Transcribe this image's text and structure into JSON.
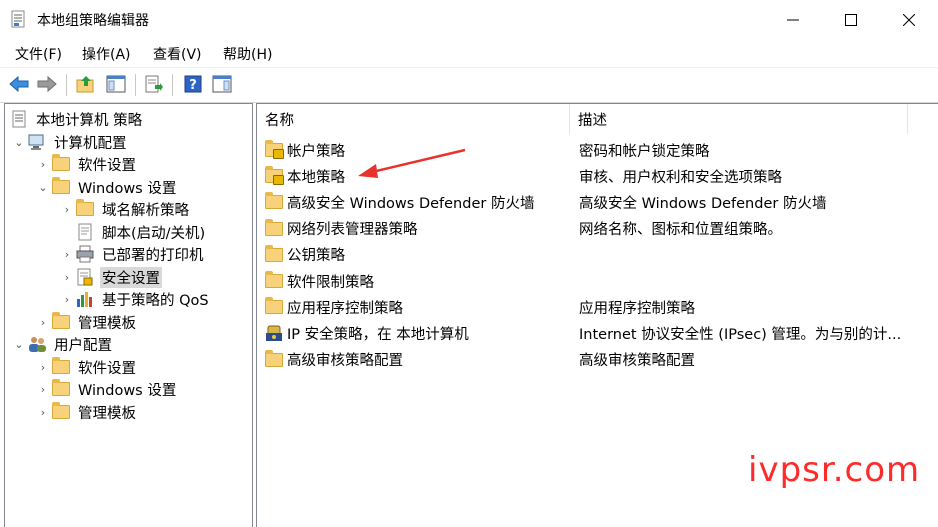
{
  "window": {
    "title": "本地组策略编辑器",
    "icon": "policy-editor-icon",
    "controls": [
      "minimize-icon",
      "maximize-icon",
      "close-icon"
    ]
  },
  "menu": {
    "file": "文件(F)",
    "action": "操作(A)",
    "view": "查看(V)",
    "help": "帮助(H)"
  },
  "toolbar": [
    "back-arrow-icon",
    "forward-arrow-icon",
    "up-folder-icon",
    "show-hide-tree-icon",
    "export-list-icon",
    "help-icon",
    "properties-icon"
  ],
  "tree": {
    "root": "本地计算机 策略",
    "computer_config": "计算机配置",
    "software_settings": "软件设置",
    "windows_settings": "Windows 设置",
    "dns_policy": "域名解析策略",
    "scripts": "脚本(启动/关机)",
    "deployed_printers": "已部署的打印机",
    "security_settings": "安全设置",
    "qos": "基于策略的 QoS",
    "admin_templates": "管理模板",
    "user_config": "用户配置",
    "user_software_settings": "软件设置",
    "user_windows_settings": "Windows 设置",
    "user_admin_templates": "管理模板"
  },
  "list": {
    "columns": {
      "name": "名称",
      "description": "描述"
    },
    "rows": [
      {
        "name": "帐户策略",
        "description": "密码和帐户锁定策略",
        "icon": "locked-folder-icon"
      },
      {
        "name": "本地策略",
        "description": "审核、用户权利和安全选项策略",
        "icon": "locked-folder-icon"
      },
      {
        "name": "高级安全 Windows Defender 防火墙",
        "description": "高级安全 Windows Defender 防火墙",
        "icon": "folder-icon"
      },
      {
        "name": "网络列表管理器策略",
        "description": "网络名称、图标和位置组策略。",
        "icon": "folder-icon"
      },
      {
        "name": "公钥策略",
        "description": "",
        "icon": "folder-icon"
      },
      {
        "name": "软件限制策略",
        "description": "",
        "icon": "folder-icon"
      },
      {
        "name": "应用程序控制策略",
        "description": "应用程序控制策略",
        "icon": "folder-icon"
      },
      {
        "name": "IP 安全策略，在 本地计算机",
        "description": "Internet 协议安全性 (IPsec) 管理。为与别的计...",
        "icon": "ip-security-icon"
      },
      {
        "name": "高级审核策略配置",
        "description": "高级审核策略配置",
        "icon": "folder-icon"
      }
    ]
  },
  "watermark": "ivpsr.com",
  "colors": {
    "arrow": "#e8322c",
    "watermark": "#ff2a2a",
    "selection": "#d9d9d9"
  }
}
